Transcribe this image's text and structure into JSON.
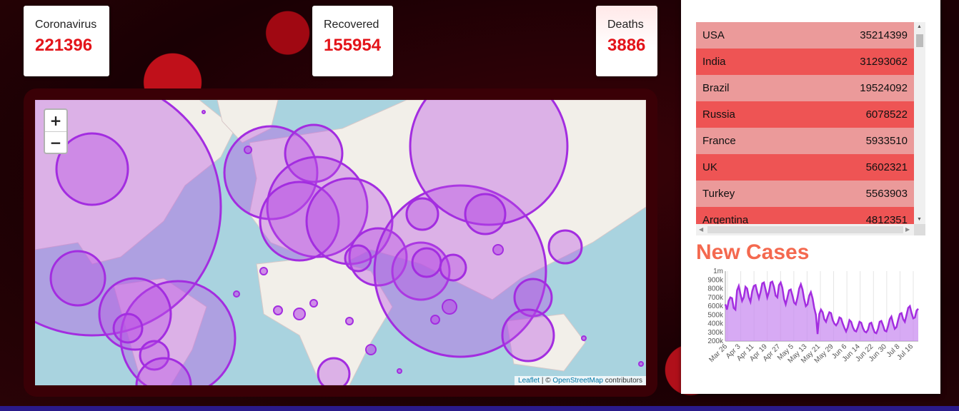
{
  "stats": {
    "cases": {
      "label": "Coronavirus",
      "value": "221396"
    },
    "recovered": {
      "label": "Recovered",
      "value": "155954"
    },
    "deaths": {
      "label": "Deaths",
      "value": "3886"
    }
  },
  "map": {
    "zoom_in": "+",
    "zoom_out": "−",
    "attribution": {
      "leaflet": "Leaflet",
      "sep": " | © ",
      "osm": "OpenStreetMap",
      "suffix": " contributors"
    }
  },
  "countries": [
    {
      "name": "USA",
      "cases": "35214399"
    },
    {
      "name": "India",
      "cases": "31293062"
    },
    {
      "name": "Brazil",
      "cases": "19524092"
    },
    {
      "name": "Russia",
      "cases": "6078522"
    },
    {
      "name": "France",
      "cases": "5933510"
    },
    {
      "name": "UK",
      "cases": "5602321"
    },
    {
      "name": "Turkey",
      "cases": "5563903"
    },
    {
      "name": "Argentina",
      "cases": "4812351"
    }
  ],
  "new_cases": {
    "title": "New Cases"
  },
  "chart_data": {
    "type": "area",
    "title": "New Cases",
    "xlabel": "",
    "ylabel": "",
    "ylim": [
      200000,
      1000000
    ],
    "y_ticks": [
      "1m",
      "900k",
      "800k",
      "700k",
      "600k",
      "500k",
      "400k",
      "300k",
      "200k"
    ],
    "x_ticks": [
      "Mar 26",
      "Apr 3",
      "Apr 11",
      "Apr 19",
      "Apr 27",
      "May 5",
      "May 13",
      "May 21",
      "May 29",
      "Jun 6",
      "Jun 14",
      "Jun 22",
      "Jun 30",
      "Jul 8",
      "Jul 16"
    ],
    "series": [
      {
        "color": "#a32de0",
        "fill": "#c98ef0",
        "values": [
          620000,
          560000,
          660000,
          700000,
          690000,
          580000,
          560000,
          780000,
          830000,
          740000,
          660000,
          700000,
          820000,
          800000,
          700000,
          650000,
          770000,
          830000,
          840000,
          760000,
          690000,
          760000,
          860000,
          870000,
          790000,
          700000,
          760000,
          870000,
          880000,
          820000,
          720000,
          700000,
          840000,
          870000,
          810000,
          680000,
          620000,
          700000,
          780000,
          790000,
          720000,
          640000,
          620000,
          700000,
          800000,
          850000,
          790000,
          680000,
          600000,
          620000,
          720000,
          760000,
          690000,
          580000,
          500000,
          280000,
          510000,
          560000,
          530000,
          450000,
          420000,
          480000,
          530000,
          520000,
          440000,
          400000,
          380000,
          410000,
          470000,
          460000,
          400000,
          350000,
          310000,
          360000,
          440000,
          420000,
          360000,
          320000,
          310000,
          360000,
          420000,
          410000,
          350000,
          310000,
          300000,
          330000,
          400000,
          410000,
          350000,
          300000,
          290000,
          340000,
          420000,
          430000,
          380000,
          320000,
          310000,
          370000,
          450000,
          480000,
          400000,
          340000,
          360000,
          440000,
          510000,
          520000,
          450000,
          420000,
          500000,
          580000,
          600000,
          520000,
          460000,
          470000,
          550000,
          570000
        ]
      }
    ]
  },
  "colors": {
    "accent_red": "#e3141a",
    "title_orange": "#f4694f",
    "row_odd": "#eb9a9a",
    "row_even": "#ee5454",
    "circle": "#a32de0"
  }
}
